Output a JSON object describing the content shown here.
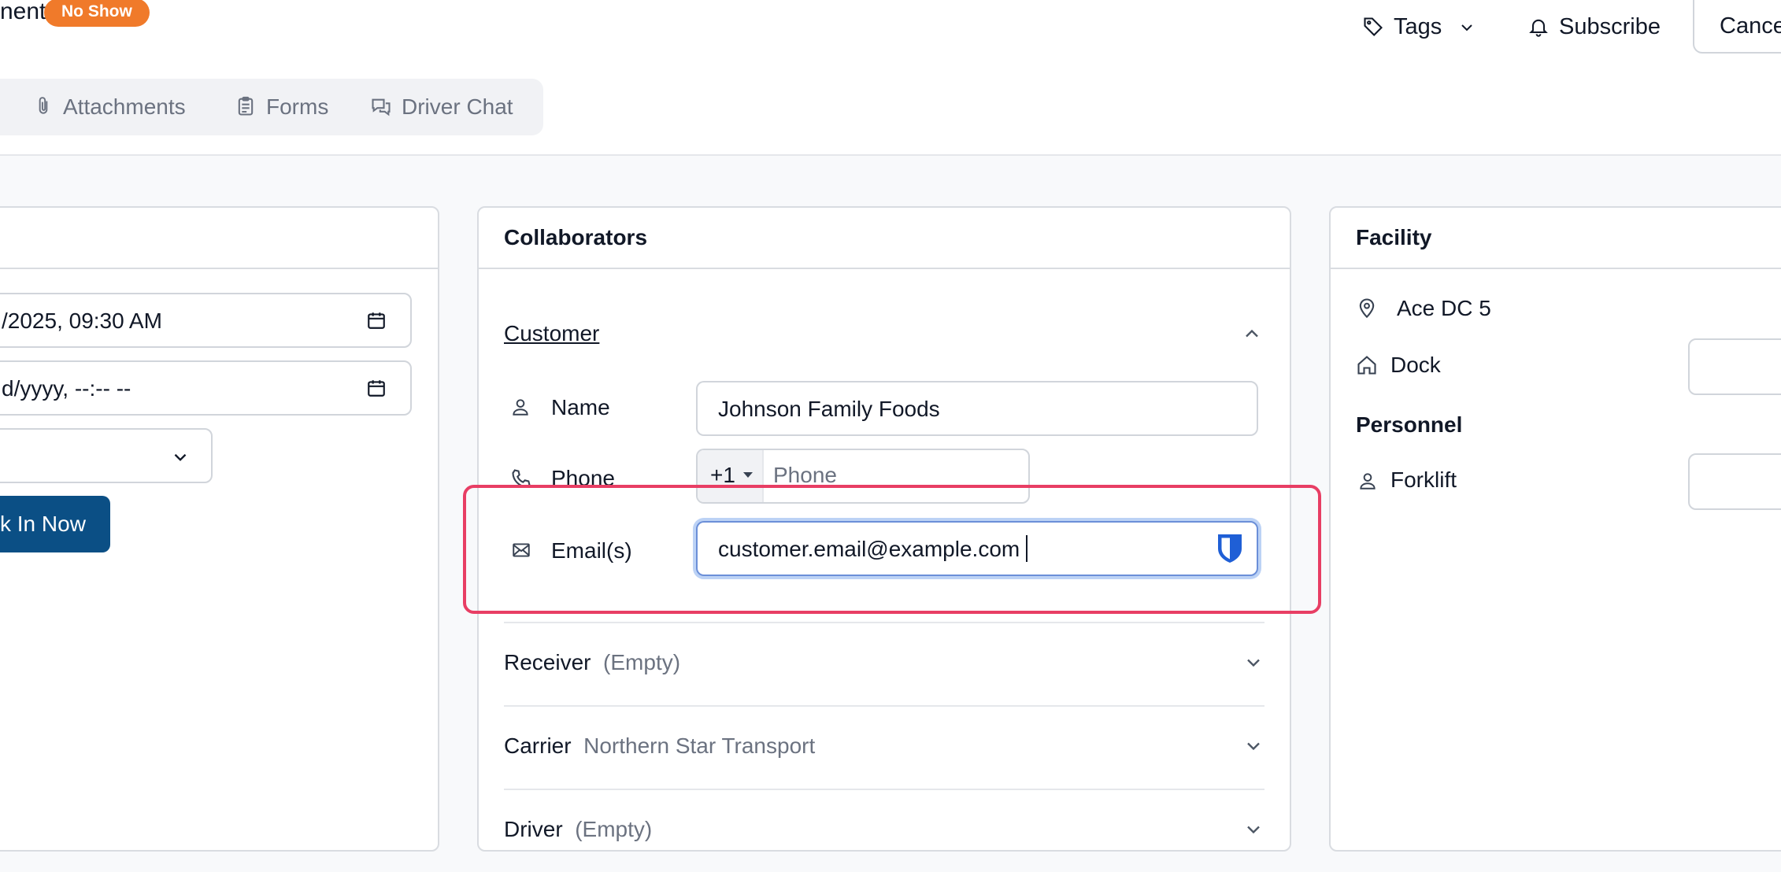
{
  "header": {
    "title_fragment": "nent",
    "status_badge": "No Show",
    "tags_label": "Tags",
    "subscribe_label": "Subscribe",
    "cancel_label": "Cance"
  },
  "tabs": [
    {
      "label": "Attachments",
      "icon": "paperclip-icon"
    },
    {
      "label": "Forms",
      "icon": "clipboard-icon"
    },
    {
      "label": "Driver Chat",
      "icon": "chat-icon"
    }
  ],
  "left_card": {
    "start_datetime": "/2025, 09:30  AM",
    "end_datetime": "d/yyyy, --:-- --",
    "check_in_label": "k In Now"
  },
  "collaborators": {
    "title": "Collaborators",
    "customer": {
      "label": "Customer",
      "name_label": "Name",
      "name_value": "Johnson Family Foods",
      "phone_label": "Phone",
      "phone_code": "+1",
      "phone_placeholder": "Phone",
      "email_label": "Email(s)",
      "email_value": "customer.email@example.com"
    },
    "sections": [
      {
        "label": "Receiver",
        "value": "(Empty)"
      },
      {
        "label": "Carrier",
        "value": "Northern Star Transport"
      },
      {
        "label": "Driver",
        "value": "(Empty)"
      }
    ]
  },
  "facility": {
    "title": "Facility",
    "location": "Ace DC 5",
    "dock_label": "Dock",
    "personnel_title": "Personnel",
    "forklift_label": "Forklift"
  },
  "colors": {
    "badge": "#f07a2a",
    "primary_button": "#0b4f85",
    "highlight": "#e83e64",
    "focus_ring": "#bcd2f5"
  }
}
